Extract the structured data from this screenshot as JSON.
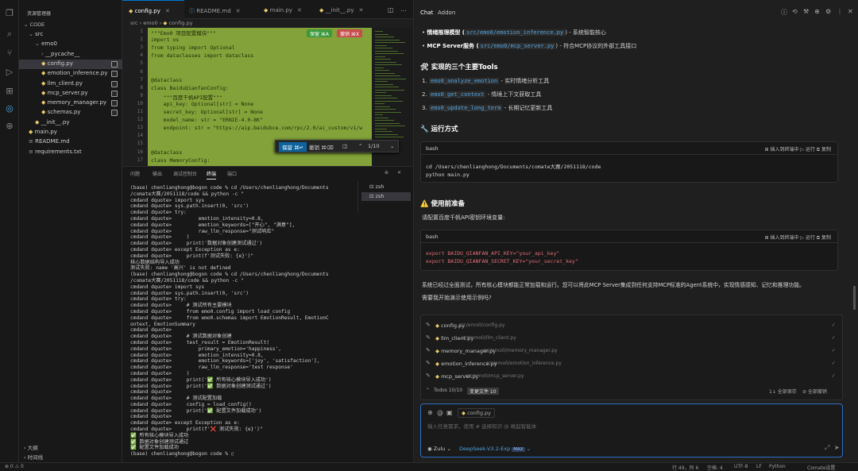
{
  "sidebar": {
    "title": "资源管理器",
    "root": "CODE",
    "items": [
      {
        "label": "src",
        "indent": 1,
        "arrow": "⌄"
      },
      {
        "label": "emo0",
        "indent": 2,
        "arrow": "⌄"
      },
      {
        "label": "__pycache__",
        "indent": 3,
        "arrow": "›"
      },
      {
        "label": "config.py",
        "indent": 3,
        "arrow": "",
        "selected": true
      },
      {
        "label": "emotion_inference.py",
        "indent": 3,
        "arrow": ""
      },
      {
        "label": "llm_client.py",
        "indent": 3,
        "arrow": ""
      },
      {
        "label": "mcp_server.py",
        "indent": 3,
        "arrow": ""
      },
      {
        "label": "memory_manager.py",
        "indent": 3,
        "arrow": ""
      },
      {
        "label": "schemas.py",
        "indent": 3,
        "arrow": ""
      },
      {
        "label": "__init__.py",
        "indent": 2,
        "arrow": ""
      },
      {
        "label": "main.py",
        "indent": 1,
        "arrow": ""
      },
      {
        "label": "README.md",
        "indent": 1,
        "arrow": ""
      },
      {
        "label": "requirements.txt",
        "indent": 1,
        "arrow": ""
      }
    ],
    "outline": "大纲",
    "timeline": "时间线"
  },
  "tabs": [
    {
      "label": "config.py"
    },
    {
      "label": "README.md"
    },
    {
      "label": "main.py"
    },
    {
      "label": "__init__.py"
    }
  ],
  "breadcrumb": "src › emo0 › ",
  "editor": {
    "accept_label": "保留 ⌘A",
    "reject_label": "撤销 ⌘X",
    "lines": [
      {
        "n": "1",
        "text": "\"\"\"Emo0 项目配置模块\"\"\""
      },
      {
        "n": "2",
        "text": "import os"
      },
      {
        "n": "3",
        "text": "from typing import Optional"
      },
      {
        "n": "4",
        "text": "from dataclasses import dataclass"
      },
      {
        "n": "5",
        "text": ""
      },
      {
        "n": "6",
        "text": ""
      },
      {
        "n": "7",
        "text": "@dataclass"
      },
      {
        "n": "8",
        "text": "class BaiduQianfanConfig:"
      },
      {
        "n": "9",
        "text": "    \"\"\"百度千帆API配置\"\"\""
      },
      {
        "n": "10",
        "text": "    api_key: Optional[str] = None"
      },
      {
        "n": "11",
        "text": "    secret_key: Optional[str] = None"
      },
      {
        "n": "12",
        "text": "    model_name: str = \"ERNIE-4.0-8K\""
      },
      {
        "n": "13",
        "text": "    endpoint: str = \"https://aip.baidubce.com/rpc/2.0/ai_custom/v1/w"
      },
      {
        "n": "14",
        "text": ""
      },
      {
        "n": "15",
        "text": ""
      },
      {
        "n": "16",
        "text": "@dataclass"
      },
      {
        "n": "17",
        "text": "class MemoryConfig:"
      }
    ],
    "findbar": {
      "keep": "保留 ⌘↵",
      "undo": "撤销 ⌘⌫",
      "count": "1/10"
    }
  },
  "panel": {
    "tabs": [
      "问题",
      "输出",
      "调试控制台",
      "终端",
      "端口"
    ],
    "terminal_list": [
      "zsh",
      "zsh"
    ],
    "terminal": "(base) chenlianghong@bogon code % cd /Users/chenlianghong/Documents\n/comate大赛/2051118/code && python -c \"\ncmdand dquote> import sys\ncmdand dquote> sys.path.insert(0, 'src')\ncmdand dquote> try:\ncmdand dquote>         emotion_intensity=0.8,\ncmdand dquote>         emotion_keywords=[\"开心\", \"满意\"],\ncmdand dquote>         raw_llm_response=\"测试响应\"\ncmdand dquote>     )\ncmdand dquote>     print('数据对象创建测试通过')\ncmdand dquote> except Exception as e:\ncmdand dquote>     print(f'测试失败: {e}')\"\n核心数据结构导入成功\n测试失败: name '高兴' is not defined\n(base) chenlianghong@bogon code % cd /Users/chenlianghong/Documents\n/comate大赛/2051118/code && python -c \"\ncmdand dquote> import sys\ncmdand dquote> sys.path.insert(0, 'src')\ncmdand dquote> try:\ncmdand dquote>     # 测试所有主要模块\ncmdand dquote>     from emo0.config import load_config\ncmdand dquote>     from emo0.schemas import EmotionResult, EmotionC\nontext, EmotionSummary\ncmdand dquote>\ncmdand dquote>     # 测试数据对象创建\ncmdand dquote>     test_result = EmotionResult(\ncmdand dquote>         primary_emotion='happiness',\ncmdand dquote>         emotion_intensity=0.8,\ncmdand dquote>         emotion_keywords=['joy', 'satisfaction'],\ncmdand dquote>         raw_llm_response='test response'\ncmdand dquote>     )\ncmdand dquote>     print('✅ 所有核心模块导入成功')\ncmdand dquote>     print('✅ 数据对象创建测试通过')\ncmdand dquote>\ncmdand dquote>     # 测试配置加载\ncmdand dquote>     config = load_config()\ncmdand dquote>     print('✅ 配置文件加载成功')\ncmdand dquote>\ncmdand dquote> except Exception as e:\ncmdand dquote>     print(f'❌ 测试失败: {e}')\"\n✅ 所有核心模块导入成功\n✅ 数据对象创建测试通过\n✅ 配置文件加载成功\n(base) chenlianghong@bogon code % ▯"
  },
  "chat": {
    "tabs": [
      "Chat",
      "Addon"
    ],
    "bullets": [
      {
        "pre": "情绪推理模型 (",
        "code": "src/emo0/emotion_inference.py",
        "post": ") - 系统智能核心"
      },
      {
        "pre": "MCP Server服务 (",
        "code": "src/emo0/mcp_server.py",
        "post": ") - 符合MCP协议的外部工具接口"
      }
    ],
    "tools_heading": "🛠 实现的三个主要Tools",
    "tools": [
      {
        "num": "1.",
        "code": "emo0_analyze_emotion",
        "desc": " - 实时情绪分析工具"
      },
      {
        "num": "2.",
        "code": "emo0_get_context",
        "desc": " - 情境上下文获取工具"
      },
      {
        "num": "3.",
        "code": "emo0_update_long_term",
        "desc": " - 长期记忆更新工具"
      }
    ],
    "run_heading": "🔧 运行方式",
    "block1": {
      "lang": "bash",
      "actions": "⊞ 插入到终端中   ▷ 运行   ⧉ 复制",
      "code": "cd /Users/chenlianghong/Documents/comate大赛/2051118/code\npython main.py"
    },
    "prep_heading": "⚠️ 使用前准备",
    "prep_text": "请配置百度千帆API密钥环境变量:",
    "block2": {
      "lang": "bash",
      "actions": "⊞ 插入到终端中   ▷ 运行   ⧉ 复制",
      "code": "export BAIDU_QIANFAN_API_KEY=\"your_api_key\"\nexport BAIDU_QIANFAN_SECRET_KEY=\"your_secret_key\""
    },
    "summary": "系统已经过全面测试，所有核心模块都能正常加载和运行。您可以将此MCP Server集成到任何支持MCP标准的Agent系统中，实现情感感知、记忆和推理功能。",
    "question": "需要我开始演示使用示例吗?",
    "files": [
      {
        "name": "config.py",
        "path": "src/emo0/config.py"
      },
      {
        "name": "llm_client.py",
        "path": "src/emo0/llm_client.py"
      },
      {
        "name": "memory_manager.py",
        "path": "src/emo0/memory_manager.py"
      },
      {
        "name": "emotion_inference.py",
        "path": "src/emo0/emotion_inference.py"
      },
      {
        "name": "mcp_server.py",
        "path": "src/emo0/mcp_server.py"
      }
    ],
    "todos": "Todos 10/10",
    "changed": "变更文件 10",
    "accept_all": "1↓ 全部保存",
    "reject_all": "⊘ 全部撤销",
    "done": "✓ 已采纳",
    "input_chip": "config.py",
    "input_placeholder": "输入任意需求，使用 # 选择知识 @ 唤起智能体",
    "agent": "Zulu",
    "model": "DeepSeek-V3.2-Exp",
    "model_tag": "MAX"
  },
  "status": {
    "left": "⊗ 0 ⚠ 0",
    "pos": "行 49，列 6",
    "spaces": "空格: 4",
    "enc": "UTF-8",
    "eol": "LF",
    "lang": "Python",
    "right": "Comate设置"
  },
  "colors": {
    "accent": "#0078d4",
    "diff_bg": "#83a23a",
    "accept": "#3c9a3c",
    "reject": "#c74b4b"
  }
}
